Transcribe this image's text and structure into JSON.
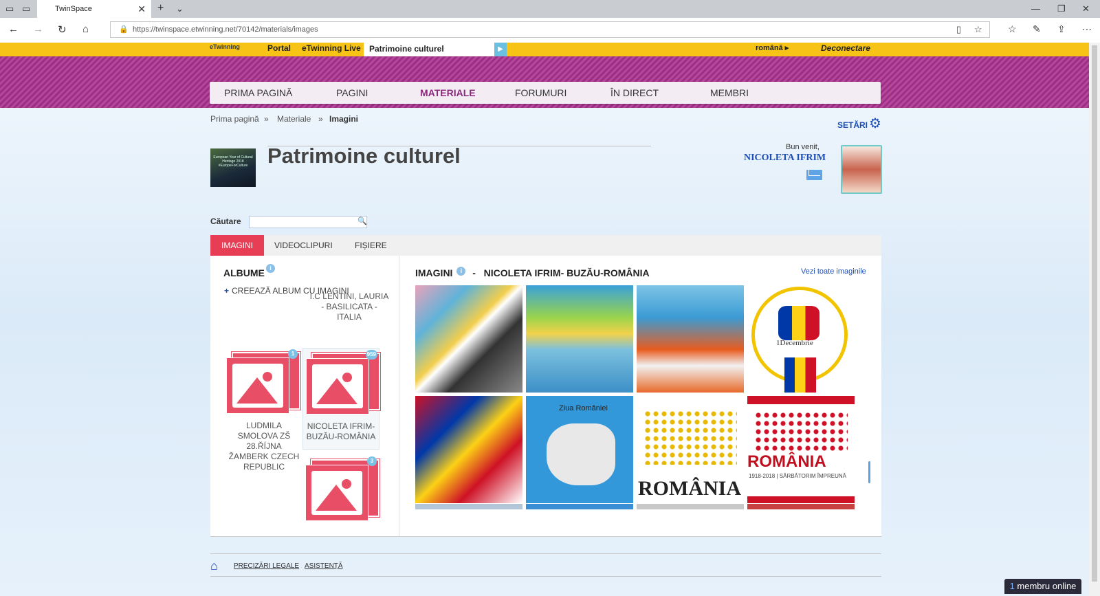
{
  "browser": {
    "tab_title": "TwinSpace",
    "url": "https://twinspace.etwinning.net/70142/materials/images"
  },
  "topstrip": {
    "logo_text": "eTwinning",
    "links": [
      "Portal",
      "eTwinning Live"
    ],
    "current_space": "Patrimoine culturel",
    "language": "română ▸",
    "logout": "Deconectare"
  },
  "menu": {
    "items": [
      "PRIMA PAGINĂ",
      "PAGINI",
      "MATERIALE",
      "FORUMURI",
      "ÎN DIRECT",
      "MEMBRI"
    ],
    "active": "MATERIALE"
  },
  "breadcrumb": {
    "items": [
      "Prima pagină",
      "Materiale",
      "Imagini"
    ],
    "separator": "»"
  },
  "settings_label": "SETĂRI",
  "space": {
    "title": "Patrimoine culturel",
    "logo_text": "European Year of Cultural Heritage 2018 #EuropeForCulture"
  },
  "user": {
    "welcome": "Bun venit,",
    "name": "NICOLETA IFRIM"
  },
  "search": {
    "label": "Căutare",
    "value": ""
  },
  "tabs": [
    "IMAGINI",
    "VIDEOCLIPURI",
    "FIȘIERE"
  ],
  "albums": {
    "title": "ALBUME",
    "create_label": "CREEAZĂ ALBUM CU IMAGINI",
    "partial_album_label": "I.C LENTINI, LAURIA - BASILICATA - ITALIA",
    "items": [
      {
        "label": "LUDMILA SMOLOVA ZŠ 28.ŘÍJNA ŽAMBERK CZECH REPUBLIC",
        "count": "1"
      },
      {
        "label": "NICOLETA IFRIM- BUZĂU-ROMÂNIA",
        "count": "959"
      },
      {
        "label": "",
        "count": "3"
      }
    ]
  },
  "images": {
    "title": "IMAGINI",
    "album_name": "NICOLETA IFRIM- BUZĂU-ROMÂNIA",
    "dash": "-",
    "see_all": "Vezi toate imaginile",
    "texts": {
      "img4": "1Decembrie",
      "img6": "Ziua României",
      "img7": "ROMÂNIA",
      "img8": "ROMÂNIA",
      "img8_sub": "1918-2018 | SĂRBĂTORIM ÎMPREUNĂ"
    }
  },
  "footer": {
    "links": [
      "PRECIZĂRI LEGALE",
      "ASISTENȚĂ"
    ]
  },
  "online": {
    "count": "1",
    "label": "membru online"
  }
}
